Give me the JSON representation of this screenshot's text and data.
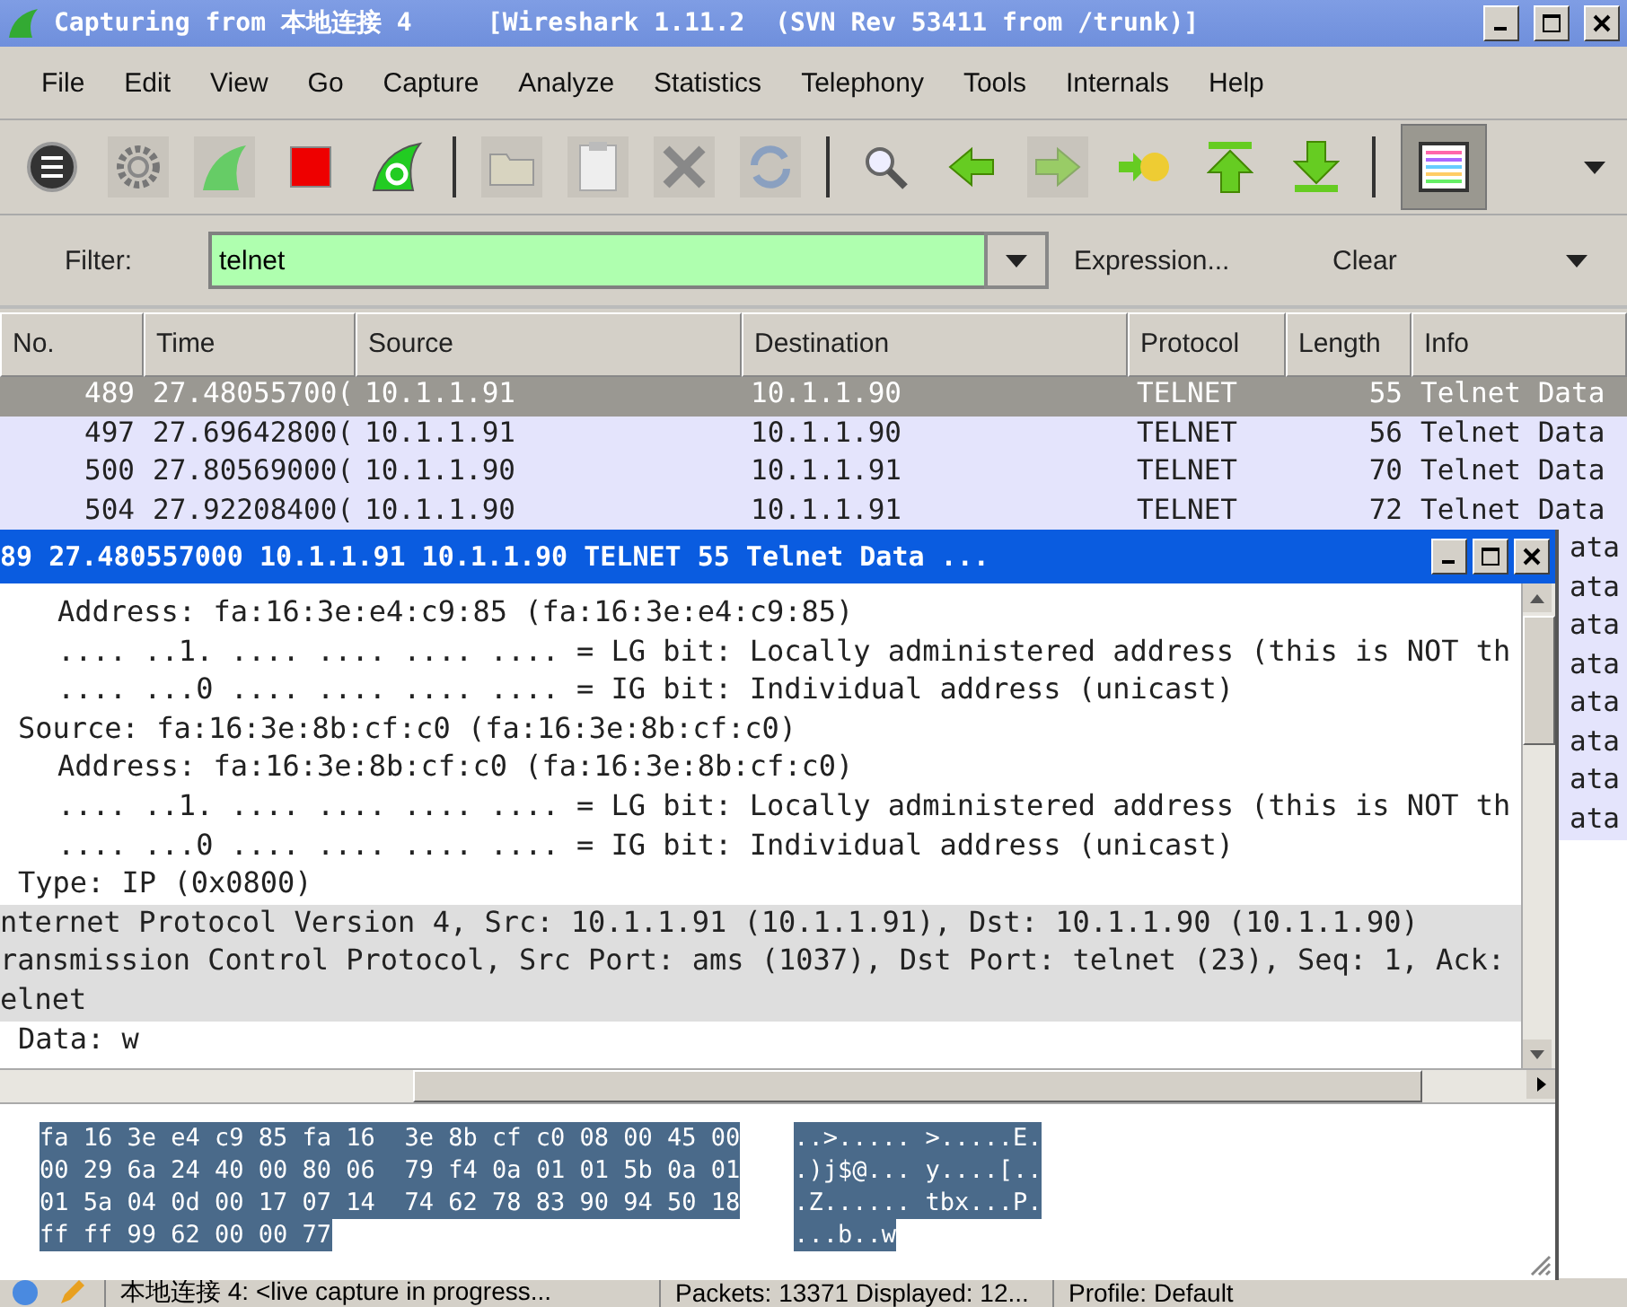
{
  "window": {
    "title": "Capturing from 本地连接 4     [Wireshark 1.11.2  (SVN Rev 53411 from /trunk)]"
  },
  "menu": [
    "File",
    "Edit",
    "View",
    "Go",
    "Capture",
    "Analyze",
    "Statistics",
    "Telephony",
    "Tools",
    "Internals",
    "Help"
  ],
  "toolbar": [
    {
      "kind": "interfaces",
      "disabled": false
    },
    {
      "kind": "options",
      "disabled": true
    },
    {
      "kind": "start",
      "disabled": true
    },
    {
      "kind": "stop",
      "disabled": false
    },
    {
      "kind": "restart",
      "disabled": false
    },
    {
      "kind": "separator"
    },
    {
      "kind": "open",
      "disabled": true
    },
    {
      "kind": "save",
      "disabled": true
    },
    {
      "kind": "close",
      "disabled": true
    },
    {
      "kind": "reload",
      "disabled": true
    },
    {
      "kind": "separator"
    },
    {
      "kind": "find",
      "disabled": false
    },
    {
      "kind": "back",
      "disabled": false
    },
    {
      "kind": "forward",
      "disabled": true
    },
    {
      "kind": "goto",
      "disabled": false
    },
    {
      "kind": "first",
      "disabled": false
    },
    {
      "kind": "last",
      "disabled": false
    },
    {
      "kind": "separator"
    },
    {
      "kind": "colorize",
      "pressed": true
    }
  ],
  "filter": {
    "label": "Filter:",
    "value": "telnet",
    "expression": "Expression...",
    "clear": "Clear"
  },
  "packet_list": {
    "columns": [
      "No.",
      "Time",
      "Source",
      "Destination",
      "Protocol",
      "Length",
      "Info"
    ],
    "rows": [
      {
        "no": "489",
        "time": "27.48055700(",
        "source": "10.1.1.91",
        "destination": "10.1.1.90",
        "protocol": "TELNET",
        "length": "55",
        "info": "Telnet Data",
        "selected": true
      },
      {
        "no": "497",
        "time": "27.69642800(",
        "source": "10.1.1.91",
        "destination": "10.1.1.90",
        "protocol": "TELNET",
        "length": "56",
        "info": "Telnet Data",
        "selected": false
      },
      {
        "no": "500",
        "time": "27.80569000(",
        "source": "10.1.1.90",
        "destination": "10.1.1.91",
        "protocol": "TELNET",
        "length": "70",
        "info": "Telnet Data",
        "selected": false
      },
      {
        "no": "504",
        "time": "27.92208400(",
        "source": "10.1.1.90",
        "destination": "10.1.1.91",
        "protocol": "TELNET",
        "length": "72",
        "info": "Telnet Data",
        "selected": false
      }
    ],
    "covered_rows": [
      {
        "info": "ata"
      },
      {
        "info": "ata"
      },
      {
        "info": "ata"
      },
      {
        "info": "ata"
      },
      {
        "info": "ata"
      },
      {
        "info": "ata"
      },
      {
        "info": "ata"
      },
      {
        "info": "ata"
      }
    ]
  },
  "packet_window": {
    "title": "89 27.480557000 10.1.1.91 10.1.1.90 TELNET 55 Telnet Data ...",
    "detail_tree": [
      {
        "children": [
          {
            "children": [
              {
                "text": "Address: fa:16:3e:e4:c9:85 (fa:16:3e:e4:c9:85)",
                "shaded": false
              },
              {
                "text": ".... ..1. .... .... .... .... = LG bit: Locally administered address (this is NOT th",
                "shaded": false
              },
              {
                "text": ".... ...0 .... .... .... .... = IG bit: Individual address (unicast)",
                "shaded": false
              }
            ]
          },
          {
            "text": "Source: fa:16:3e:8b:cf:c0 (fa:16:3e:8b:cf:c0)",
            "shaded": false,
            "children": [
              {
                "text": "Address: fa:16:3e:8b:cf:c0 (fa:16:3e:8b:cf:c0)",
                "shaded": false
              },
              {
                "text": ".... ..1. .... .... .... .... = LG bit: Locally administered address (this is NOT th",
                "shaded": false
              },
              {
                "text": ".... ...0 .... .... .... .... = IG bit: Individual address (unicast)",
                "shaded": false
              }
            ]
          },
          {
            "text": "Type: IP (0x0800)",
            "shaded": false
          }
        ]
      },
      {
        "text": "nternet Protocol Version 4, Src: 10.1.1.91 (10.1.1.91), Dst: 10.1.1.90 (10.1.1.90)",
        "shaded": true
      },
      {
        "text": "ransmission Control Protocol, Src Port: ams (1037), Dst Port: telnet (23), Seq: 1, Ack:",
        "shaded": true
      },
      {
        "text": "elnet",
        "shaded": true,
        "children": [
          {
            "text": "Data: w",
            "shaded": false
          }
        ]
      }
    ],
    "hex_rows": [
      {
        "hex": "fa 16 3e e4 c9 85 fa 16  3e 8b cf c0 08 00 45 00",
        "ascii": "..>..... >.....E."
      },
      {
        "hex": "00 29 6a 24 40 00 80 06  79 f4 0a 01 01 5b 0a 01",
        "ascii": ".)j$@... y....[.."
      },
      {
        "hex": "01 5a 04 0d 00 17 07 14  74 62 78 83 90 94 50 18",
        "ascii": ".Z...... tbx...P."
      },
      {
        "hex": "ff ff 99 62 00 00 77",
        "ascii": "...b..w"
      }
    ]
  },
  "status_bar": [
    "本地连接 4: <live capture in progress...",
    "Packets: 13371    Displayed: 12...",
    "Profile: Default"
  ]
}
